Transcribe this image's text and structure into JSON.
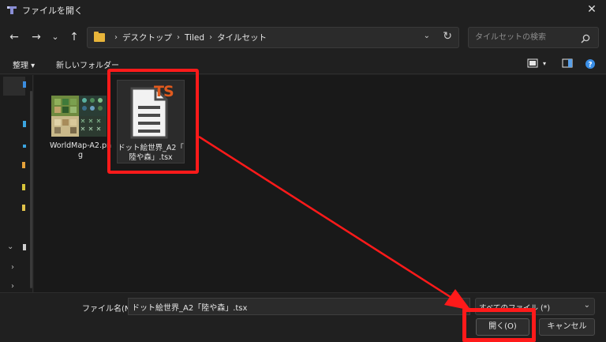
{
  "window": {
    "title": "ファイルを開く",
    "close_glyph": "✕"
  },
  "nav": {
    "back_glyph": "←",
    "forward_glyph": "→",
    "recent_glyph": "⌄",
    "up_glyph": "↑",
    "breadcrumbs": [
      "デスクトップ",
      "Tiled",
      "タイルセット"
    ],
    "dropdown_glyph": "⌄",
    "refresh_glyph": "↻"
  },
  "search": {
    "placeholder": "タイルセットの検索"
  },
  "toolbar": {
    "organize_label": "整理 ▾",
    "new_folder_label": "新しいフォルダー",
    "view_dropdown_glyph": "▾",
    "help_glyph": "?"
  },
  "files": [
    {
      "name": "WorldMap-A2.pn",
      "name_line2": "g",
      "icon": "image-thumbnail-icon"
    },
    {
      "name": "ドット絵世界_A2「",
      "name_line2": "陸や森」.tsx",
      "icon": "tsx-file-icon",
      "badge": "TS"
    }
  ],
  "bottom": {
    "filename_label": "ファイル名(N):",
    "filename_value": "ドット絵世界_A2「陸や森」.tsx",
    "filter_label": "すべてのファイル (*)",
    "filter_glyph": "⌄",
    "open_label": "開く(O)",
    "cancel_label": "キャンセル"
  },
  "colors": {
    "highlight": "#ff1a1a",
    "badge": "#e05a1e",
    "folder": "#e8b53a",
    "help": "#3a8ee6"
  }
}
